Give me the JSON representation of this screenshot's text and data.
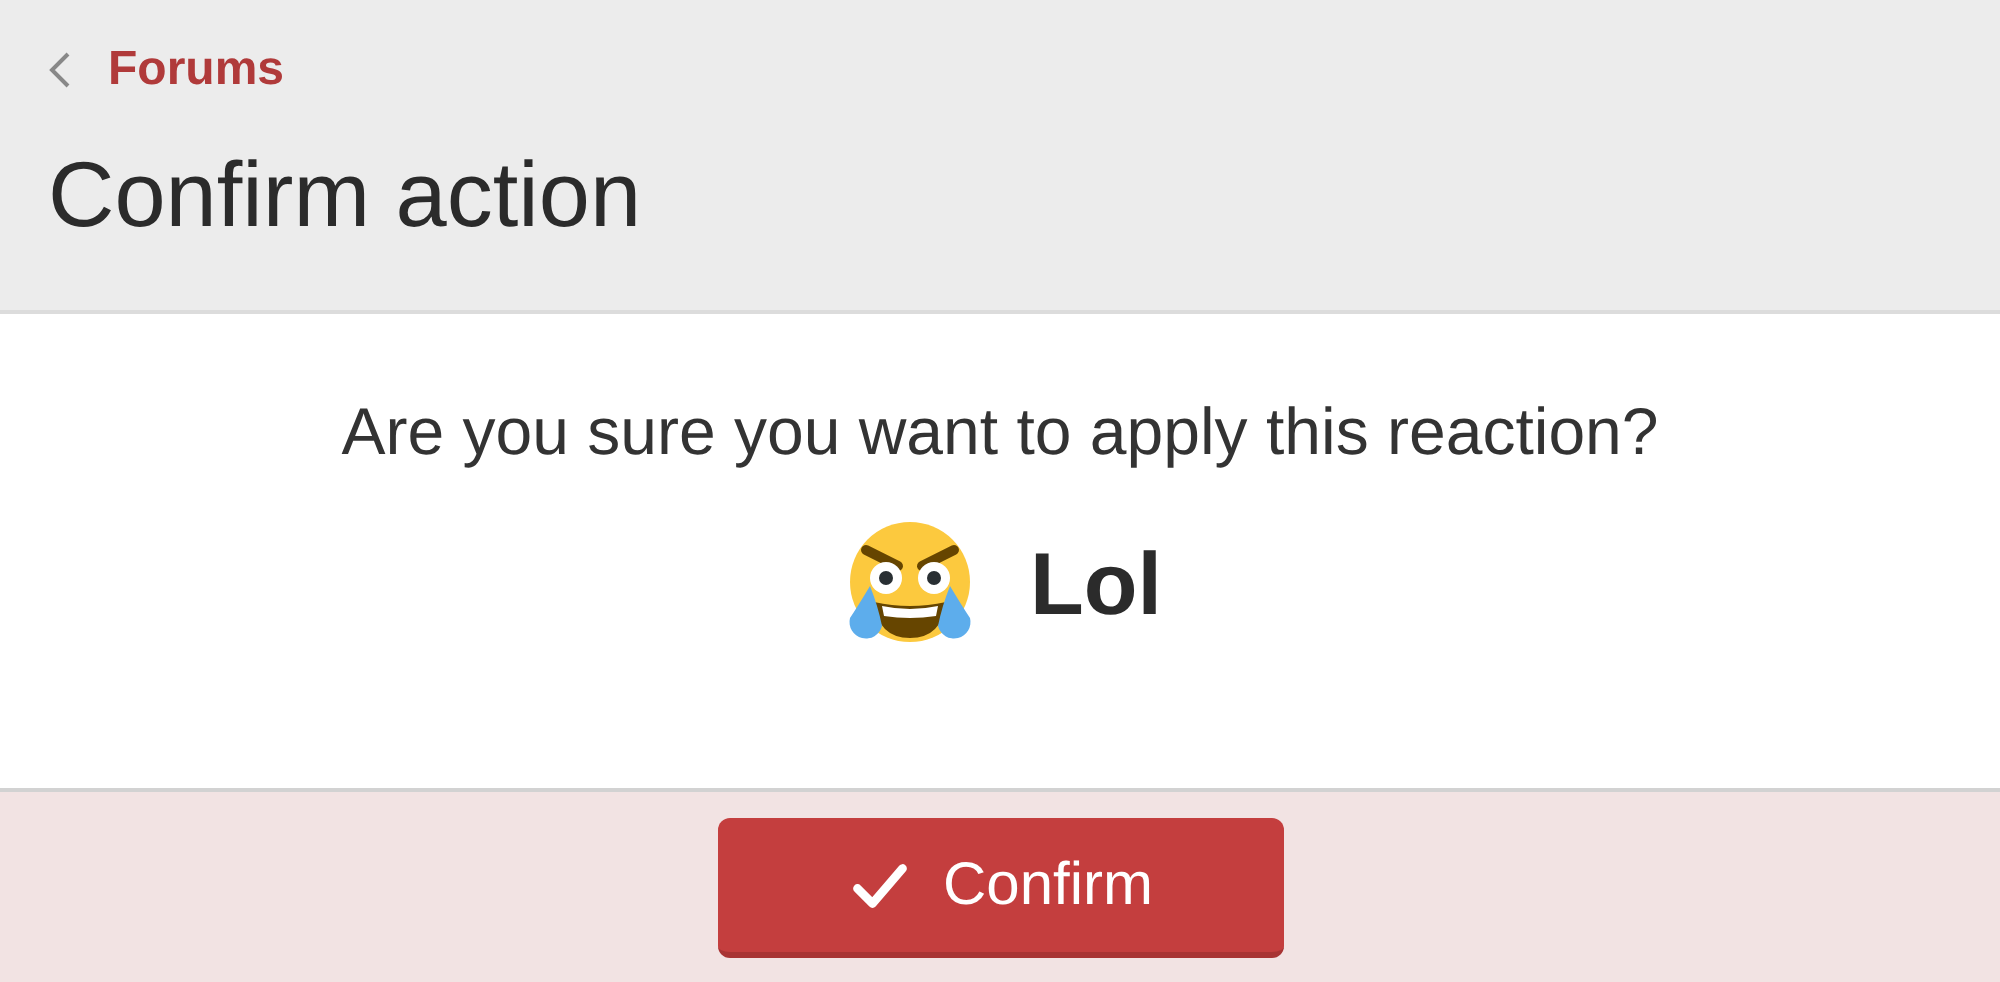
{
  "breadcrumb": {
    "label": "Forums"
  },
  "title": "Confirm action",
  "message": "Are you sure you want to apply this reaction?",
  "reaction": {
    "label": "Lol"
  },
  "buttons": [
    {
      "label": "Confirm",
      "kind": "primary"
    }
  ]
}
